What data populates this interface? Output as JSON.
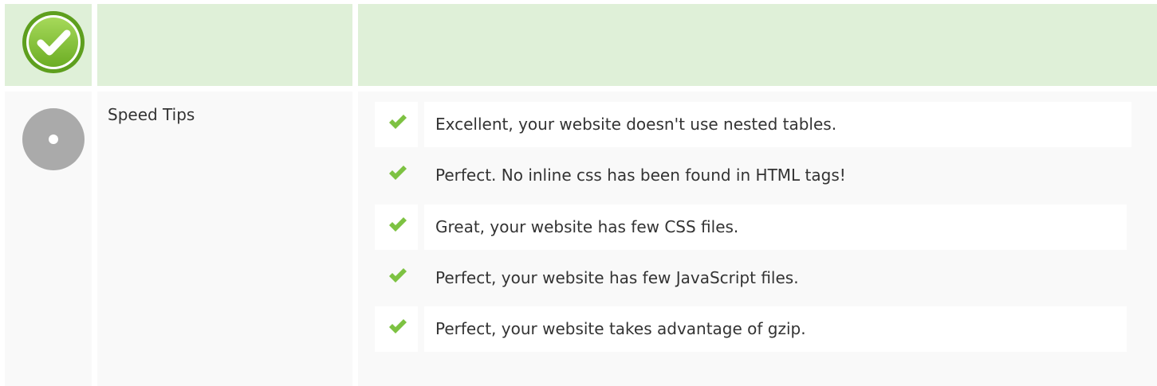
{
  "section": {
    "title": "Speed Tips",
    "colors": {
      "header_bg": "#dff0d8",
      "row_bg": "#f9f9f9",
      "check_green": "#7dc242",
      "badge_outer": "#5e9f1e",
      "info_gray": "#aaaaaa"
    },
    "header_icon": "check-badge-icon",
    "row_icon": "info-circle-icon"
  },
  "tips": [
    {
      "text": "Excellent, your website doesn't use nested tables.",
      "icon": "check-icon"
    },
    {
      "text": "Perfect. No inline css has been found in HTML tags!",
      "icon": "check-icon"
    },
    {
      "text": "Great, your website has few CSS files.",
      "icon": "check-icon"
    },
    {
      "text": "Perfect, your website has few JavaScript files.",
      "icon": "check-icon"
    },
    {
      "text": "Perfect, your website takes advantage of gzip.",
      "icon": "check-icon"
    }
  ]
}
